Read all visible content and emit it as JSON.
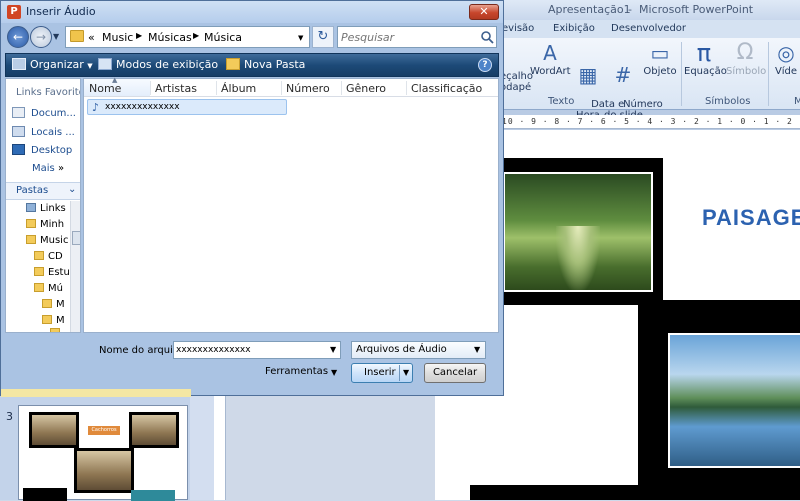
{
  "ppt": {
    "window_title": "Apresentação1",
    "window_sep": "-",
    "app_name": "Microsoft PowerPoint",
    "tabs": [
      "evisão",
      "Exibição",
      "Desenvolvedor"
    ],
    "ribbon": {
      "items": [
        {
          "label": "eçalho\nodapé",
          "icon": "header-footer-icon"
        },
        {
          "label": "WordArt",
          "icon": "wordart-icon"
        },
        {
          "label": "Data e\nHora",
          "icon": "date-time-icon"
        },
        {
          "label": "Número\ndo slide",
          "icon": "slide-number-icon"
        },
        {
          "label": "Objeto",
          "icon": "object-icon"
        },
        {
          "label": "Equação",
          "icon": "pi-icon"
        },
        {
          "label": "Símbolo",
          "icon": "omega-icon"
        },
        {
          "label": "Víde",
          "icon": "video-icon"
        }
      ],
      "groups": [
        "Texto",
        "Símbolos",
        "M"
      ],
      "equation_glyph": "π",
      "symbol_glyph": "Ω"
    },
    "ruler_text": "10 · 9 · 8 · 7 · 6 · 5 · 4 · 3 · 2 · 1 · 0 · 1 · 2",
    "slide_title": "PAISAGEN",
    "thumbnail": {
      "number": "3",
      "tag": "Cachorros"
    }
  },
  "dialog": {
    "title": "Inserir Áudio",
    "app_icon_letter": "P",
    "close_glyph": "✕",
    "nav": {
      "back_glyph": "←",
      "forward_glyph": "→",
      "history_glyph": "▼"
    },
    "breadcrumb": {
      "overflow": "«",
      "parts": [
        "Music",
        "Músicas",
        "Música"
      ],
      "separator": "▶"
    },
    "refresh_glyph": "↻",
    "search": {
      "placeholder": "Pesquisar"
    },
    "toolbar": {
      "organize": "Organizar",
      "views": "Modos de exibição",
      "new_folder": "Nova Pasta",
      "dropdown_glyph": "▼",
      "help_glyph": "?"
    },
    "nav_pane": {
      "favorites_header": "Links Favoritos",
      "favorites": [
        "Docum...",
        "Locais ...",
        "Desktop"
      ],
      "more": "Mais",
      "more_glyph": "»",
      "folders_header": "Pastas",
      "folders_chevron": "⌄",
      "tree": [
        "Links",
        "Minh",
        "Music",
        "CD",
        "Estu",
        "Mú",
        "M",
        "M",
        ""
      ]
    },
    "columns": [
      "Nome",
      "Artistas",
      "Álbum",
      "Número",
      "Gênero",
      "Classificação"
    ],
    "sort_glyph": "▲",
    "files": [
      {
        "name": "xxxxxxxxxxxxxx",
        "icon": "audio-file-icon",
        "icon_glyph": "♪"
      }
    ],
    "filename": {
      "label": "Nome do arquivo:",
      "value": "xxxxxxxxxxxxxx"
    },
    "file_type": {
      "selected": "Arquivos de Áudio"
    },
    "tools_label": "Ferramentas",
    "insert_label": "Inserir",
    "cancel_label": "Cancelar"
  }
}
